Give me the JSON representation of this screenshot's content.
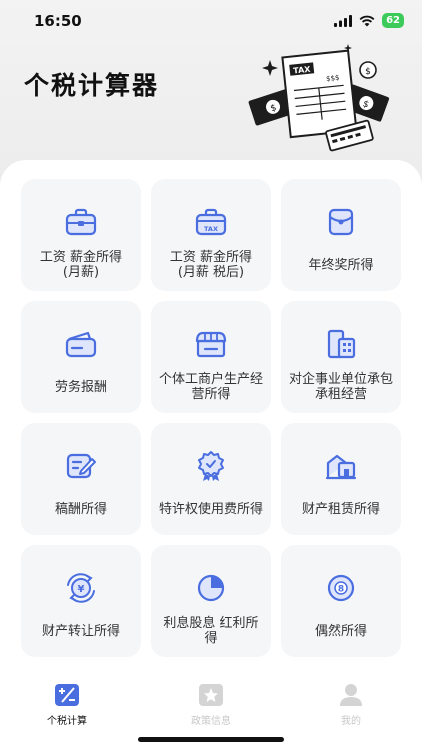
{
  "status_bar": {
    "time": "16:50",
    "battery": "62"
  },
  "header": {
    "title": "个税计算器",
    "illustration_label": "TAX",
    "illustration_amount": "$$$"
  },
  "items": [
    {
      "label": "工资 薪金所得\n(月薪)",
      "icon": "briefcase-icon"
    },
    {
      "label": "工资 薪金所得\n(月薪 税后)",
      "icon": "tax-briefcase-icon"
    },
    {
      "label": "年终奖所得",
      "icon": "red-envelope-icon"
    },
    {
      "label": "劳务报酬",
      "icon": "wallet-icon"
    },
    {
      "label": "个体工商户生产经营所得",
      "icon": "shop-icon"
    },
    {
      "label": "对企事业单位承包 承租经营",
      "icon": "building-icon"
    },
    {
      "label": "稿酬所得",
      "icon": "edit-icon"
    },
    {
      "label": "特许权使用费所得",
      "icon": "badge-icon"
    },
    {
      "label": "财产租赁所得",
      "icon": "house-icon"
    },
    {
      "label": "财产转让所得",
      "icon": "yuan-transfer-icon"
    },
    {
      "label": "利息股息 红利所得",
      "icon": "pie-chart-icon"
    },
    {
      "label": "偶然所得",
      "icon": "lottery-ball-icon"
    }
  ],
  "tabs": [
    {
      "label": "个税计算",
      "active": true
    },
    {
      "label": "政策信息",
      "active": false
    },
    {
      "label": "我的",
      "active": false
    }
  ],
  "colors": {
    "accent": "#4a6ee0",
    "icon_fill": "#dfe6fb",
    "tab_inactive": "#c8c8c8"
  }
}
